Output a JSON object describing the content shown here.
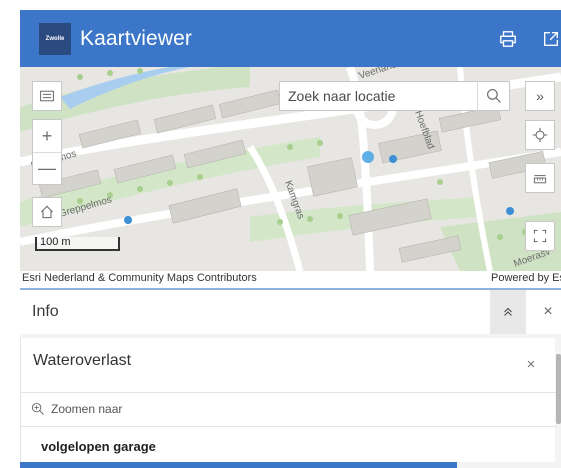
{
  "header": {
    "logo_text": "Zwolle",
    "title": "Kaartviewer",
    "print_icon": "printer-icon",
    "share_icon": "share-icon",
    "brand_color": "#3b76c8"
  },
  "map": {
    "search_placeholder": "Zoek naar locatie",
    "search_icon": "search-icon",
    "expand_label": "»",
    "zoom_in_label": "+",
    "zoom_out_label": "—",
    "scale_label": "100 m",
    "attribution_left": "Esri Nederland & Community Maps Contributors",
    "attribution_right": "Powered by Es",
    "street_labels": [
      "Uweelmos",
      "Greppelmos",
      "Kamgras",
      "Hoefblad",
      "Moerasv",
      "Veenand"
    ]
  },
  "info_panel": {
    "title": "Info",
    "collapse_icon": "chevron-up-double-icon",
    "close_label": "×"
  },
  "feature": {
    "layer_title": "Wateroverlast",
    "close_label": "×",
    "zoom_to_label": "Zoomen naar",
    "name": "volgelopen garage"
  }
}
